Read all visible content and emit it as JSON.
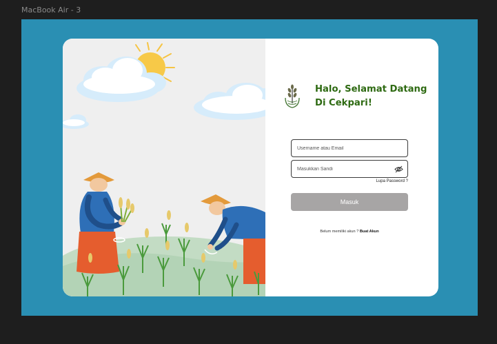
{
  "frame": {
    "label": "MacBook Air - 3"
  },
  "login": {
    "welcome_title": "Halo, Selamat Datang Di Cekpari!",
    "username_placeholder": "Username atau Email",
    "password_placeholder": "Masukkan Sandi",
    "forgot_password": "Lupa Password ?",
    "login_button": "Masuk",
    "no_account_text": "Belum memiliki akun ?",
    "create_account_link": "Buat Akun"
  },
  "icons": {
    "logo": "rice-plant-logo",
    "password_toggle": "eye-slash-icon"
  },
  "colors": {
    "frame_bg": "#2a8fb3",
    "card_bg": "#ffffff",
    "title": "#2e6a12",
    "button": "#a7a5a5",
    "page_bg": "#1e1e1e"
  }
}
